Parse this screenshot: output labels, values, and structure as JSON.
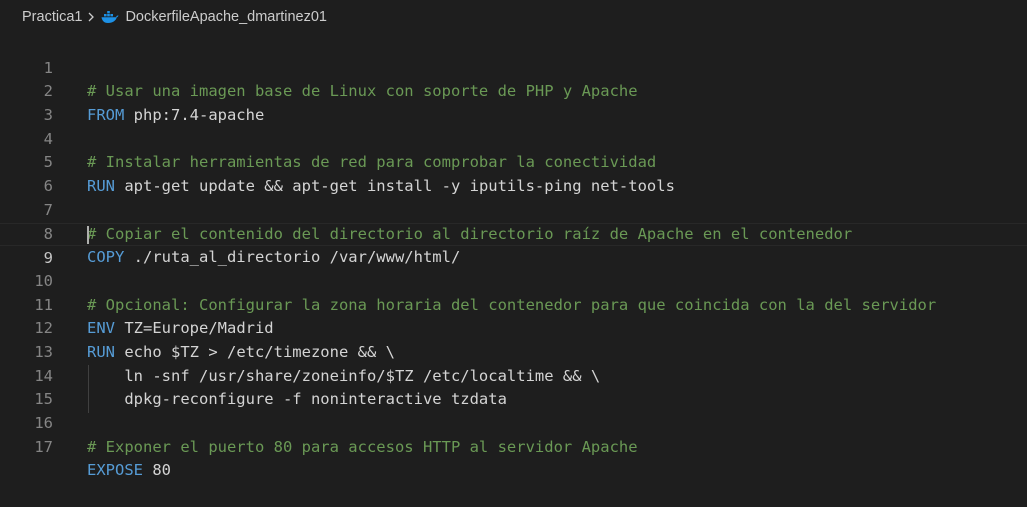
{
  "breadcrumb": {
    "folder": "Practica1",
    "file": "DockerfileApache_dmartinez01",
    "file_icon": "docker-icon"
  },
  "editor": {
    "current_line": 9,
    "lines": [
      {
        "n": "1",
        "comment": "# Usar una imagen base de Linux con soporte de PHP y Apache"
      },
      {
        "n": "2",
        "kw": "FROM",
        "text": " php:7.4-apache"
      },
      {
        "n": "3"
      },
      {
        "n": "4",
        "comment": "# Instalar herramientas de red para comprobar la conectividad"
      },
      {
        "n": "5",
        "kw": "RUN",
        "text": " apt-get update && apt-get install -y iputils-ping net-tools"
      },
      {
        "n": "6"
      },
      {
        "n": "7",
        "comment": "# Copiar el contenido del directorio al directorio raíz de Apache en el contenedor"
      },
      {
        "n": "8",
        "kw": "COPY",
        "text": " ./ruta_al_directorio /var/www/html/"
      },
      {
        "n": "9"
      },
      {
        "n": "10",
        "comment": "# Opcional: Configurar la zona horaria del contenedor para que coincida con la del servidor"
      },
      {
        "n": "11",
        "kw": "ENV",
        "text": " TZ=Europe/Madrid"
      },
      {
        "n": "12",
        "kw": "RUN",
        "text": " echo $TZ > /etc/timezone && \\"
      },
      {
        "n": "13",
        "text": "    ln -snf /usr/share/zoneinfo/$TZ /etc/localtime && \\"
      },
      {
        "n": "14",
        "text": "    dpkg-reconfigure -f noninteractive tzdata"
      },
      {
        "n": "15"
      },
      {
        "n": "16",
        "comment": "# Exponer el puerto 80 para accesos HTTP al servidor Apache"
      },
      {
        "n": "17",
        "kw": "EXPOSE",
        "text": " 80"
      }
    ]
  },
  "colors": {
    "background": "#1e1e1e",
    "comment": "#6a9955",
    "keyword": "#569cd6",
    "text": "#d4d4d4",
    "line_number": "#858585",
    "docker_blue": "#1d91e6"
  }
}
